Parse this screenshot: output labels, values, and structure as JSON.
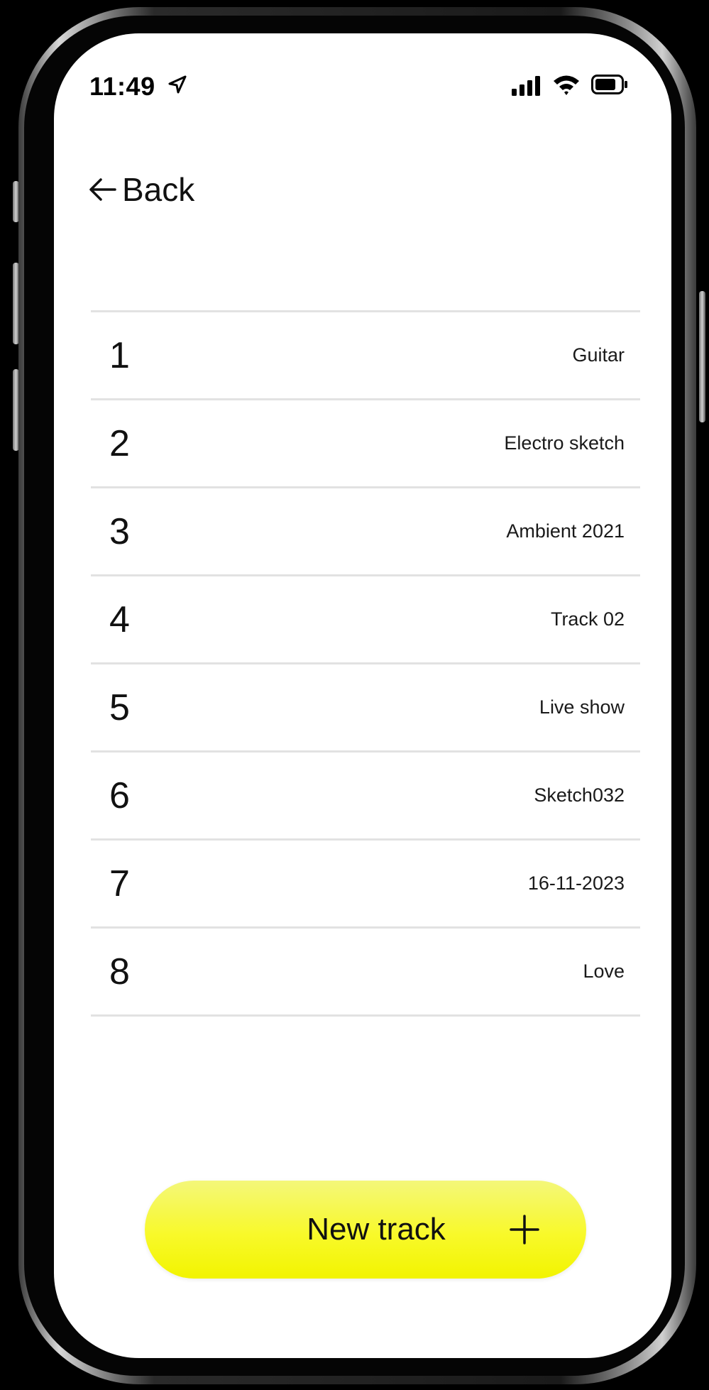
{
  "status_bar": {
    "time": "11:49",
    "icons": [
      "location-arrow-icon",
      "cellular-signal-icon",
      "wifi-icon",
      "battery-icon"
    ]
  },
  "navigation": {
    "back_label": "Back",
    "back_icon": "arrow-left-icon"
  },
  "tracks": [
    {
      "number": "1",
      "name": "Guitar"
    },
    {
      "number": "2",
      "name": "Electro sketch"
    },
    {
      "number": "3",
      "name": "Ambient 2021"
    },
    {
      "number": "4",
      "name": "Track 02"
    },
    {
      "number": "5",
      "name": "Live show"
    },
    {
      "number": "6",
      "name": "Sketch032"
    },
    {
      "number": "7",
      "name": "16-11-2023"
    },
    {
      "number": "8",
      "name": "Love"
    }
  ],
  "new_track_button": {
    "label": "New track",
    "icon": "plus-icon"
  },
  "colors": {
    "accent": "#f8f92a",
    "divider": "#e2e2e2",
    "text": "#111111",
    "background": "#ffffff"
  }
}
